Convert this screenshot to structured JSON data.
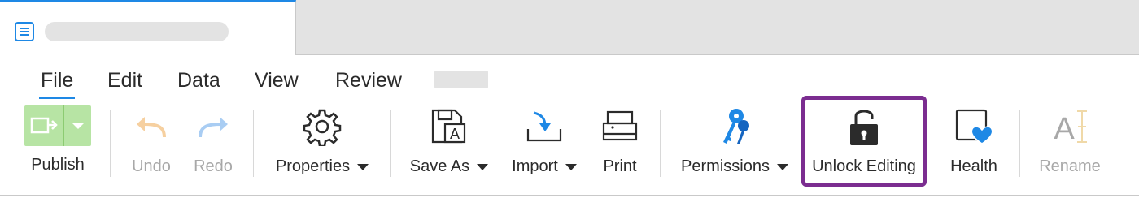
{
  "tab": {
    "icon": "document-lines-icon",
    "title": ""
  },
  "menu": {
    "items": [
      {
        "label": "File",
        "active": true
      },
      {
        "label": "Edit"
      },
      {
        "label": "Data"
      },
      {
        "label": "View"
      },
      {
        "label": "Review"
      }
    ]
  },
  "ribbon": {
    "publish": {
      "label": "Publish",
      "icon": "publish-icon",
      "color": "#b7e4a4"
    },
    "undo": {
      "label": "Undo",
      "icon": "undo-arrow-icon",
      "enabled": false
    },
    "redo": {
      "label": "Redo",
      "icon": "redo-arrow-icon",
      "enabled": false
    },
    "properties": {
      "label": "Properties",
      "icon": "gear-icon"
    },
    "save_as": {
      "label": "Save As",
      "icon": "save-as-icon"
    },
    "import": {
      "label": "Import",
      "icon": "import-tray-icon"
    },
    "print": {
      "label": "Print",
      "icon": "printer-icon"
    },
    "permissions": {
      "label": "Permissions",
      "icon": "keys-icon"
    },
    "unlock_editing": {
      "label": "Unlock Editing",
      "icon": "padlock-icon",
      "highlighted": true,
      "highlight_color": "#7b2d90"
    },
    "health": {
      "label": "Health",
      "icon": "health-heart-icon"
    },
    "rename": {
      "label": "Rename",
      "icon": "rename-text-cursor-icon",
      "enabled": false
    }
  },
  "colors": {
    "accent": "#1e88e5",
    "publish_green": "#b7e4a4",
    "highlight_purple": "#7b2d90",
    "disabled_text": "#a8a8a8"
  }
}
